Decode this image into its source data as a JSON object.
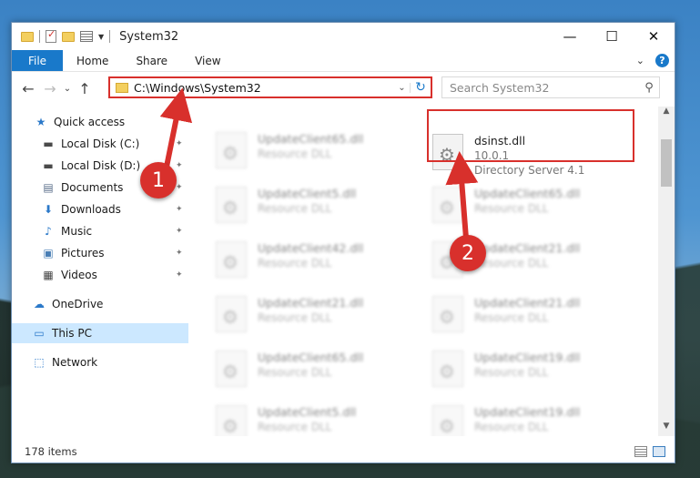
{
  "window": {
    "title": "System32",
    "controls": {
      "minimize": "—",
      "maximize": "☐",
      "close": "✕"
    }
  },
  "ribbon": {
    "tabs": [
      "File",
      "Home",
      "Share",
      "View"
    ],
    "expand": "⌄",
    "help": "?"
  },
  "nav": {
    "back": "←",
    "forward": "→",
    "recent": "⌄",
    "up": "↑",
    "address": "C:\\Windows\\System32",
    "dropdown": "⌄",
    "refresh": "↻",
    "search_placeholder": "Search System32",
    "search_icon": "⚲"
  },
  "sidebar": {
    "items": [
      {
        "label": "Quick access",
        "icon": "star-icon",
        "glyph": "★",
        "color": "#2b79c9"
      },
      {
        "label": "Local Disk (C:)",
        "icon": "drive-icon",
        "glyph": "▬",
        "color": "#4a4a4a",
        "pinned": true
      },
      {
        "label": "Local Disk (D:)",
        "icon": "drive-icon",
        "glyph": "▬",
        "color": "#4a4a4a",
        "pinned": true
      },
      {
        "label": "Documents",
        "icon": "documents-icon",
        "glyph": "▤",
        "color": "#5a6e8a",
        "pinned": true
      },
      {
        "label": "Downloads",
        "icon": "download-icon",
        "glyph": "⬇",
        "color": "#2b79c9",
        "pinned": true
      },
      {
        "label": "Music",
        "icon": "music-icon",
        "glyph": "♪",
        "color": "#2b79c9",
        "pinned": true
      },
      {
        "label": "Pictures",
        "icon": "pictures-icon",
        "glyph": "▣",
        "color": "#4a7fb5",
        "pinned": true
      },
      {
        "label": "Videos",
        "icon": "videos-icon",
        "glyph": "▦",
        "color": "#444",
        "pinned": true
      },
      {
        "label": "OneDrive",
        "icon": "cloud-icon",
        "glyph": "☁",
        "color": "#2b79c9"
      },
      {
        "label": "This PC",
        "icon": "computer-icon",
        "glyph": "▭",
        "color": "#2b79c9",
        "selected": true
      },
      {
        "label": "Network",
        "icon": "network-icon",
        "glyph": "⬚",
        "color": "#2b79c9"
      }
    ],
    "pin_glyph": "📌"
  },
  "files": {
    "highlighted": {
      "name": "dsinst.dll",
      "version": "10.0.1",
      "description": "Directory Server 4.1"
    },
    "left_column": [
      {
        "name": "UpdateClient65.dll",
        "type": "Resource DLL"
      },
      {
        "name": "UpdateClient5.dll",
        "type": "Resource DLL"
      },
      {
        "name": "UpdateClient42.dll",
        "type": "Resource DLL"
      },
      {
        "name": "UpdateClient21.dll",
        "type": "Resource DLL"
      },
      {
        "name": "UpdateClient65.dll",
        "type": "Resource DLL"
      },
      {
        "name": "UpdateClient5.dll",
        "type": "Resource DLL"
      }
    ],
    "right_column": [
      {
        "name": "UpdateClient65.dll",
        "type": "Resource DLL"
      },
      {
        "name": "UpdateClient21.dll",
        "type": "Resource DLL"
      },
      {
        "name": "UpdateClient21.dll",
        "type": "Resource DLL"
      },
      {
        "name": "UpdateClient19.dll",
        "type": "Resource DLL"
      },
      {
        "name": "UpdateClient19.dll",
        "type": "Resource DLL"
      }
    ],
    "gear_glyph": "⚙"
  },
  "status": {
    "count": "178 items"
  },
  "annotations": {
    "badge1": "1",
    "badge2": "2",
    "accent": "#d8302c"
  }
}
